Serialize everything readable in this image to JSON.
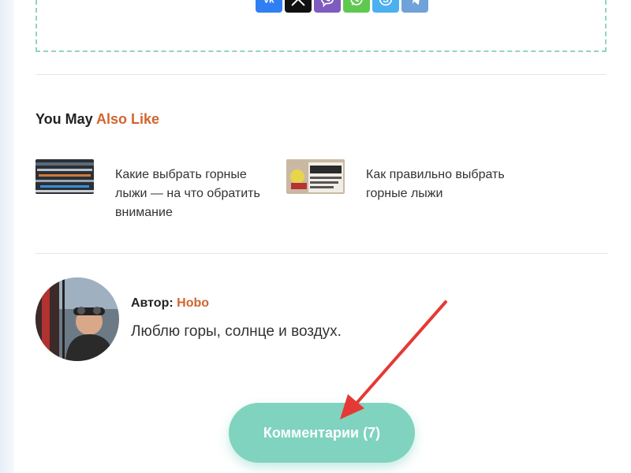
{
  "share": {
    "buttons": [
      {
        "name": "vk",
        "icon": "vk-icon",
        "color": "#2f7ff2"
      },
      {
        "name": "x",
        "icon": "x-icon",
        "color": "#111111"
      },
      {
        "name": "viber",
        "icon": "viber-icon",
        "color": "#7d5bbf"
      },
      {
        "name": "whatsapp",
        "icon": "whatsapp-icon",
        "color": "#5fc94f"
      },
      {
        "name": "skype",
        "icon": "skype-icon",
        "color": "#4cb0f0"
      },
      {
        "name": "telegram",
        "icon": "telegram-icon",
        "color": "#6fa2d8"
      }
    ]
  },
  "related": {
    "title_plain": "You May",
    "title_accent": "Also Like",
    "items": [
      {
        "title": "Какие выбрать горные лыжи — на что обратить внимание"
      },
      {
        "title": "Как правильно выбрать горные лыжи"
      }
    ]
  },
  "author": {
    "label": "Автор:",
    "name": "Hobo",
    "bio": "Люблю горы, солнце и воздух."
  },
  "comments": {
    "label": "Комментарии (7)"
  },
  "colors": {
    "accent": "#d0652f",
    "button": "#7fd3bf",
    "dashed_border": "#8fd5c1",
    "arrow": "#e53935"
  }
}
